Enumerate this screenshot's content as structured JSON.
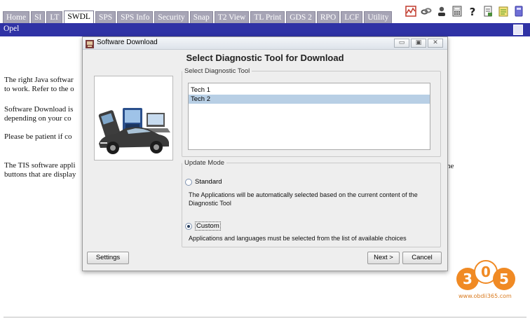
{
  "tabs": [
    "Home",
    "SI",
    "LT",
    "SWDL",
    "SPS",
    "SPS Info",
    "Security",
    "Snap",
    "T2 View",
    "TL Print",
    "GDS 2",
    "RPO",
    "LCF",
    "Utility"
  ],
  "active_tab": "SWDL",
  "toolbar_icons": [
    "chart-icon",
    "link-icon",
    "user-icon",
    "calculator-icon",
    "help-icon",
    "document-icon",
    "notes-icon",
    "book-icon"
  ],
  "brand_bar": {
    "label": "Opel",
    "icon": "document-icon"
  },
  "background_text": {
    "line1": "The right Java softwar",
    "line2": "to work. Refer to the o",
    "line3": "Software Download is",
    "line4": "depending on your co",
    "line5": "Please be patient if co",
    "line6": "The TIS software appli",
    "line7": "buttons that are display",
    "line6_trail": "he"
  },
  "dialog": {
    "title": "Software Download",
    "controls": {
      "minimize": "▭",
      "maximize": "▣",
      "close": "✕"
    },
    "heading": "Select Diagnostic Tool for Download",
    "tool_group_label": "Select Diagnostic Tool",
    "tools": [
      {
        "label": "Tech 1",
        "selected": false
      },
      {
        "label": "Tech 2",
        "selected": true
      }
    ],
    "mode_group_label": "Update Mode",
    "modes": {
      "standard": {
        "label": "Standard",
        "selected": false,
        "description": "The Applications will be automatically selected based on the current content of the Diagnostic Tool"
      },
      "custom": {
        "label": "Custom",
        "selected": true,
        "description": "Applications and languages must be selected from the list of available choices"
      }
    },
    "buttons": {
      "settings": "Settings",
      "next": "Next >",
      "cancel": "Cancel"
    }
  },
  "watermark": {
    "logo": "305-logo",
    "url": "www.obdii365.com"
  },
  "colors": {
    "tab_bg": "#a7a5b6",
    "brand_bar": "#2f32a5",
    "selection": "#b8cfe5",
    "watermark": "#f08a24"
  }
}
